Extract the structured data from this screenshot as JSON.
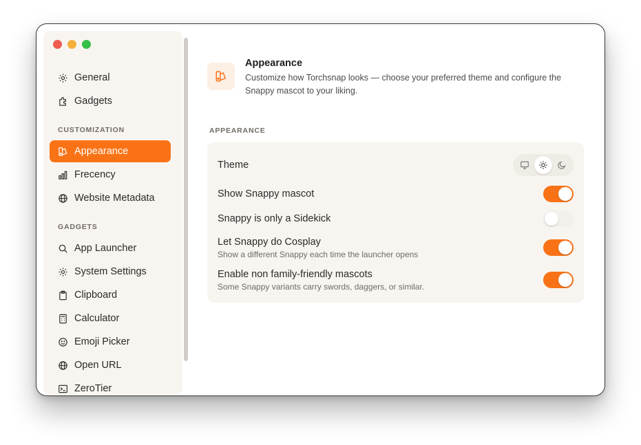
{
  "sidebar": {
    "items_top": [
      {
        "label": "General",
        "icon": "gear-icon"
      },
      {
        "label": "Gadgets",
        "icon": "puzzle-icon"
      }
    ],
    "sections": [
      {
        "label": "CUSTOMIZATION",
        "items": [
          {
            "label": "Appearance",
            "icon": "palette-icon",
            "active": true
          },
          {
            "label": "Frecency",
            "icon": "bar-chart-icon"
          },
          {
            "label": "Website Metadata",
            "icon": "globe-icon"
          }
        ]
      },
      {
        "label": "GADGETS",
        "items": [
          {
            "label": "App Launcher",
            "icon": "search-icon"
          },
          {
            "label": "System Settings",
            "icon": "gear-icon"
          },
          {
            "label": "Clipboard",
            "icon": "clipboard-icon"
          },
          {
            "label": "Calculator",
            "icon": "calculator-icon"
          },
          {
            "label": "Emoji Picker",
            "icon": "smiley-icon"
          },
          {
            "label": "Open URL",
            "icon": "globe-icon"
          },
          {
            "label": "ZeroTier",
            "icon": "terminal-icon"
          }
        ]
      }
    ]
  },
  "header": {
    "title": "Appearance",
    "description": "Customize how Torchsnap looks — choose your preferred theme and configure the Snappy mascot to your liking."
  },
  "group": {
    "label": "APPEARANCE",
    "theme": {
      "label": "Theme",
      "options": [
        "monitor-icon",
        "sun-icon",
        "moon-icon"
      ],
      "selected": "sun-icon"
    },
    "settings": [
      {
        "label": "Show Snappy mascot",
        "sub": "",
        "on": true
      },
      {
        "label": "Snappy is only a Sidekick",
        "sub": "",
        "on": false
      },
      {
        "label": "Let Snappy do Cosplay",
        "sub": "Show a different Snappy each time the launcher opens",
        "on": true
      },
      {
        "label": "Enable non family-friendly mascots",
        "sub": "Some Snappy variants carry swords, daggers, or similar.",
        "on": true
      }
    ]
  },
  "colors": {
    "accent": "#f97316",
    "sidebar_bg": "#f8f5f0"
  }
}
